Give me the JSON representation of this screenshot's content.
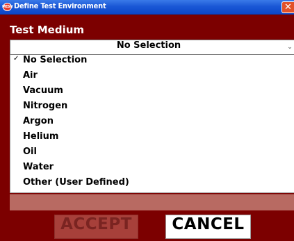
{
  "window": {
    "title": "Define Test Environment",
    "icon_label": "MESH",
    "close_glyph": "✕"
  },
  "section_heading": "Test Medium",
  "medium_select": {
    "selected": "No Selection",
    "arrow_glyph": "⌄"
  },
  "options": [
    {
      "label": "No Selection",
      "checked": true
    },
    {
      "label": "Air",
      "checked": false
    },
    {
      "label": "Vacuum",
      "checked": false
    },
    {
      "label": "Nitrogen",
      "checked": false
    },
    {
      "label": "Argon",
      "checked": false
    },
    {
      "label": "Helium",
      "checked": false
    },
    {
      "label": "Oil",
      "checked": false
    },
    {
      "label": "Water",
      "checked": false
    },
    {
      "label": "Other (User Defined)",
      "checked": false
    }
  ],
  "check_glyph": "✓",
  "buttons": {
    "accept": "ACCEPT",
    "cancel": "CANCEL"
  },
  "colors": {
    "window_background": "#7c0000",
    "title_bar": "#1b58d6",
    "info_band": "#b86a62",
    "accept_disabled": "#a7403a"
  }
}
